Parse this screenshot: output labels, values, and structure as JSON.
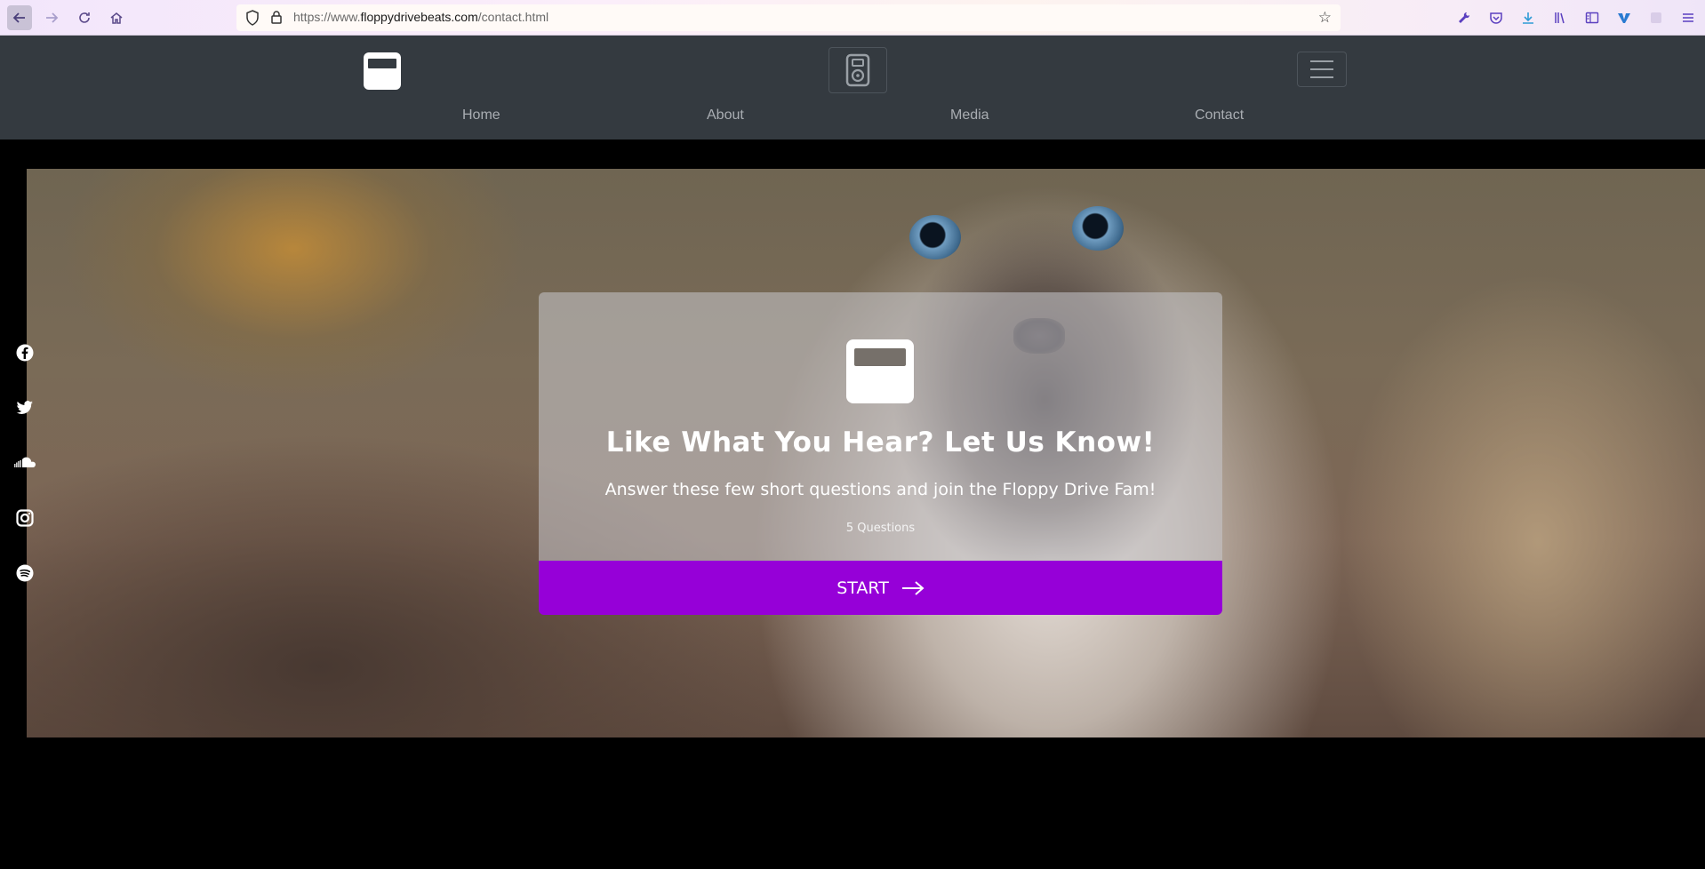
{
  "browser": {
    "url_prefix": "https://www.",
    "url_domain": "floppydrivebeats.com",
    "url_path": "/contact.html"
  },
  "icons": {
    "back": "back-arrow-icon",
    "forward": "forward-arrow-icon",
    "reload": "reload-icon",
    "home": "home-icon",
    "shield": "shield-icon",
    "lock": "lock-icon",
    "bookmark": "star-icon",
    "toolbar": [
      "wrench-icon",
      "pocket-icon",
      "download-icon",
      "library-icon",
      "sidebar-icon",
      "vpn-icon",
      "extension-icon",
      "menu-icon"
    ],
    "social": [
      "facebook-icon",
      "twitter-icon",
      "soundcloud-icon",
      "instagram-icon",
      "spotify-icon"
    ]
  },
  "nav": {
    "links": [
      {
        "label": "Home"
      },
      {
        "label": "About"
      },
      {
        "label": "Media"
      },
      {
        "label": "Contact"
      }
    ]
  },
  "hero": {
    "title": "Like What You Hear?  Let Us Know!",
    "subtitle": "Answer these few short questions and join the Floppy Drive Fam!",
    "count": "5 Questions",
    "start_label": "START"
  },
  "colors": {
    "nav_bg": "#343a40",
    "accent": "#9600d8",
    "browser_icon": "#5a3fbf"
  }
}
